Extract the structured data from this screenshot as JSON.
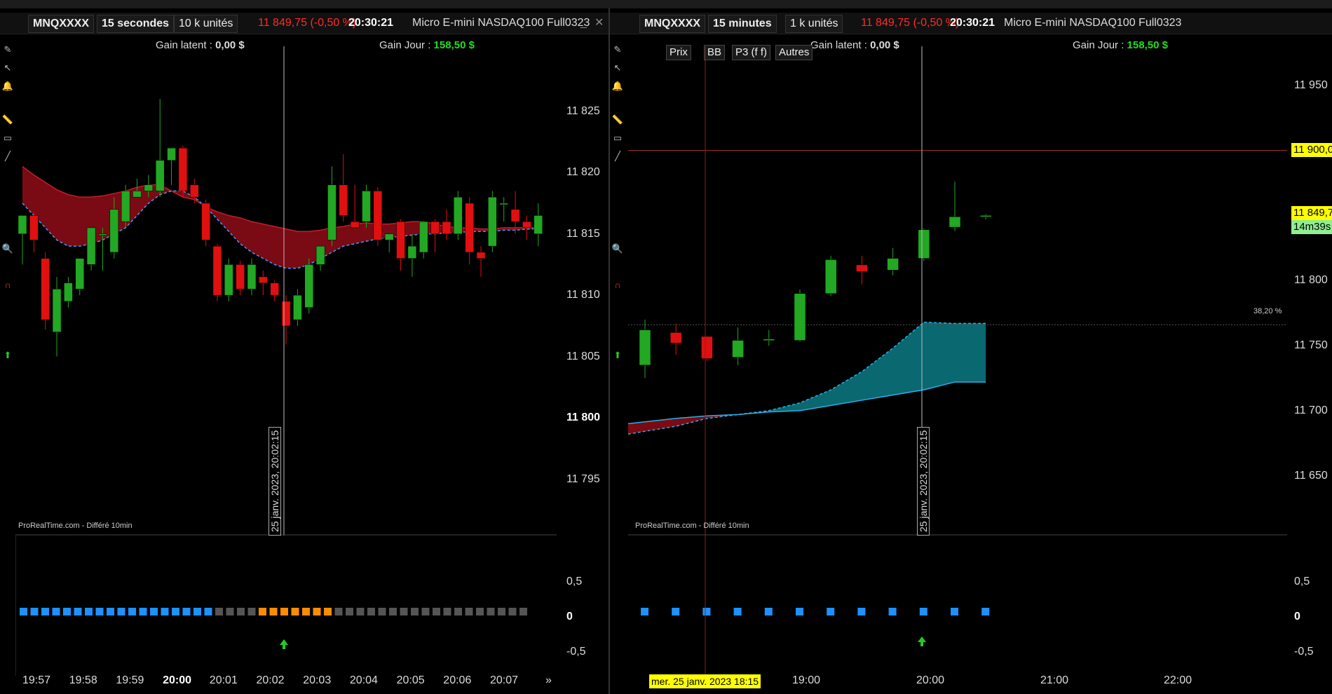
{
  "left": {
    "symbol": "MNQXXXX",
    "interval": "15 secondes",
    "units": "10 k unités",
    "price_change": "11 849,75 (-0,50 %)",
    "time": "20:30:21",
    "instrument": "Micro E-mini NASDAQ100 Full0323",
    "gain_latent_label": "Gain latent :",
    "gain_latent_value": "0,00 $",
    "gain_jour_label": "Gain Jour :",
    "gain_jour_value": "158,50 $",
    "watermark": "ProRealTime.com - Différé 10min",
    "cursor_date": "25 janv. 2023, 20:02:15",
    "price_ticks": [
      "11 825",
      "11 820",
      "11 815",
      "11 810",
      "11 805",
      "11 800",
      "11 795"
    ],
    "osc_ticks": [
      "0,5",
      "0",
      "-0,5"
    ],
    "time_ticks": [
      "19:57",
      "19:58",
      "19:59",
      "20:00",
      "20:01",
      "20:02",
      "20:03",
      "20:04",
      "20:05",
      "20:06",
      "20:07"
    ],
    "scroll_label": "»"
  },
  "right": {
    "symbol": "MNQXXXX",
    "interval": "15 minutes",
    "units": "1 k unités",
    "price_change": "11 849,75 (-0,50 %)",
    "time": "20:30:21",
    "instrument": "Micro E-mini NASDAQ100 Full0323",
    "gain_latent_label": "Gain latent :",
    "gain_latent_value": "0,00 $",
    "gain_jour_label": "Gain Jour :",
    "gain_jour_value": "158,50 $",
    "legend": [
      "Prix",
      "BB",
      "P3 (f f)",
      "Autres"
    ],
    "watermark": "ProRealTime.com - Différé 10min",
    "cursor_date": "25 janv. 2023, 20:02:15",
    "price_ticks": [
      "11 950",
      "11 800",
      "11 750",
      "11 700",
      "11 650"
    ],
    "level_tag": "11 900,0",
    "last_price_tag": "11 849,7",
    "countdown_tag": "14m39s",
    "fib_label": "38,20 %",
    "osc_ticks": [
      "0,5",
      "0",
      "-0,5"
    ],
    "date_tag": "mer. 25 janv. 2023 18:15",
    "time_ticks": [
      "19:00",
      "20:00",
      "21:00",
      "22:00"
    ]
  },
  "colors": {
    "bull": "#22a822",
    "bear": "#e01010",
    "cloud_down": "#7a0a14",
    "cloud_up": "#0a6870",
    "dot_blue": "#1e90ff",
    "dot_gray": "#555555",
    "dot_orange": "#ff8c00",
    "tag_yellow": "#ffff00",
    "tag_green": "#90ee90"
  },
  "left_candles": [
    {
      "o": 11815.0,
      "h": 11816.5,
      "l": 11812.5,
      "c": 11816.5
    },
    {
      "o": 11816.5,
      "h": 11816.8,
      "l": 11813.5,
      "c": 11814.5
    },
    {
      "o": 11813.0,
      "h": 11813.5,
      "l": 11807.2,
      "c": 11808.0
    },
    {
      "o": 11807.0,
      "h": 11811.5,
      "l": 11805.0,
      "c": 11810.5
    },
    {
      "o": 11809.5,
      "h": 11811.5,
      "l": 11809.0,
      "c": 11811.0
    },
    {
      "o": 11810.5,
      "h": 11812.0,
      "l": 11810.0,
      "c": 11813.0
    },
    {
      "o": 11812.5,
      "h": 11815.5,
      "l": 11812.0,
      "c": 11815.5
    },
    {
      "o": 11815.0,
      "h": 11815.5,
      "l": 11812.0,
      "c": 11815.0
    },
    {
      "o": 11813.5,
      "h": 11818.0,
      "l": 11813.0,
      "c": 11817.0
    },
    {
      "o": 11816.0,
      "h": 11819.0,
      "l": 11815.5,
      "c": 11818.5
    },
    {
      "o": 11818.0,
      "h": 11819.5,
      "l": 11818.0,
      "c": 11818.5
    },
    {
      "o": 11818.5,
      "h": 11819.8,
      "l": 11818.0,
      "c": 11819.0
    },
    {
      "o": 11818.5,
      "h": 11826.0,
      "l": 11818.0,
      "c": 11821.0
    },
    {
      "o": 11821.0,
      "h": 11821.5,
      "l": 11819.0,
      "c": 11822.0
    },
    {
      "o": 11822.0,
      "h": 11822.2,
      "l": 11818.0,
      "c": 11818.5
    },
    {
      "o": 11819.0,
      "h": 11819.5,
      "l": 11817.5,
      "c": 11818.0
    },
    {
      "o": 11817.5,
      "h": 11817.8,
      "l": 11814.0,
      "c": 11814.5
    },
    {
      "o": 11814.0,
      "h": 11814.2,
      "l": 11809.5,
      "c": 11810.0
    },
    {
      "o": 11810.0,
      "h": 11813.0,
      "l": 11809.5,
      "c": 11812.5
    },
    {
      "o": 11812.5,
      "h": 11812.8,
      "l": 11810.0,
      "c": 11810.5
    },
    {
      "o": 11810.5,
      "h": 11813.0,
      "l": 11810.0,
      "c": 11812.5
    },
    {
      "o": 11811.5,
      "h": 11812.0,
      "l": 11810.0,
      "c": 11811.0
    },
    {
      "o": 11811.0,
      "h": 11811.2,
      "l": 11809.5,
      "c": 11810.0
    },
    {
      "o": 11809.5,
      "h": 11810.0,
      "l": 11806.0,
      "c": 11807.5
    },
    {
      "o": 11808.0,
      "h": 11810.5,
      "l": 11807.5,
      "c": 11810.0
    },
    {
      "o": 11809.0,
      "h": 11813.0,
      "l": 11808.5,
      "c": 11812.5
    },
    {
      "o": 11812.5,
      "h": 11814.0,
      "l": 11812.0,
      "c": 11814.0
    },
    {
      "o": 11814.5,
      "h": 11820.5,
      "l": 11814.0,
      "c": 11819.0
    },
    {
      "o": 11819.0,
      "h": 11821.5,
      "l": 11816.0,
      "c": 11816.5
    },
    {
      "o": 11816.0,
      "h": 11819.0,
      "l": 11815.5,
      "c": 11815.5
    },
    {
      "o": 11816.0,
      "h": 11819.0,
      "l": 11815.5,
      "c": 11818.5
    },
    {
      "o": 11818.5,
      "h": 11818.8,
      "l": 11814.0,
      "c": 11814.5
    },
    {
      "o": 11814.5,
      "h": 11815.0,
      "l": 11813.5,
      "c": 11815.0
    },
    {
      "o": 11816.0,
      "h": 11816.2,
      "l": 11812.0,
      "c": 11813.0
    },
    {
      "o": 11813.0,
      "h": 11815.0,
      "l": 11811.5,
      "c": 11814.0
    },
    {
      "o": 11813.5,
      "h": 11816.0,
      "l": 11813.0,
      "c": 11816.0
    },
    {
      "o": 11816.0,
      "h": 11816.2,
      "l": 11813.5,
      "c": 11815.0
    },
    {
      "o": 11816.0,
      "h": 11817.0,
      "l": 11814.5,
      "c": 11815.0
    },
    {
      "o": 11815.0,
      "h": 11818.5,
      "l": 11814.5,
      "c": 11818.0
    },
    {
      "o": 11817.5,
      "h": 11818.0,
      "l": 11812.5,
      "c": 11813.5
    },
    {
      "o": 11813.5,
      "h": 11814.0,
      "l": 11811.5,
      "c": 11813.0
    },
    {
      "o": 11814.0,
      "h": 11818.5,
      "l": 11813.5,
      "c": 11818.0
    },
    {
      "o": 11817.5,
      "h": 11818.0,
      "l": 11816.0,
      "c": 11817.5
    },
    {
      "o": 11817.0,
      "h": 11818.5,
      "l": 11815.0,
      "c": 11816.0
    },
    {
      "o": 11816.0,
      "h": 11816.5,
      "l": 11814.5,
      "c": 11815.5
    },
    {
      "o": 11815.0,
      "h": 11817.5,
      "l": 11814.0,
      "c": 11816.5
    }
  ],
  "right_candles": [
    {
      "o": 11735,
      "h": 11770,
      "l": 11725,
      "c": 11762
    },
    {
      "o": 11760,
      "h": 11767,
      "l": 11743,
      "c": 11752
    },
    {
      "o": 11757,
      "h": 11757,
      "l": 11738,
      "c": 11740
    },
    {
      "o": 11741,
      "h": 11764,
      "l": 11735,
      "c": 11754
    },
    {
      "o": 11754,
      "h": 11762,
      "l": 11750,
      "c": 11755
    },
    {
      "o": 11754,
      "h": 11793,
      "l": 11753,
      "c": 11790
    },
    {
      "o": 11790,
      "h": 11819,
      "l": 11788,
      "c": 11816
    },
    {
      "o": 11812,
      "h": 11819,
      "l": 11797,
      "c": 11807
    },
    {
      "o": 11808,
      "h": 11825,
      "l": 11804,
      "c": 11817
    },
    {
      "o": 11817,
      "h": 11840,
      "l": 11815,
      "c": 11839
    },
    {
      "o": 11841,
      "h": 11876,
      "l": 11838,
      "c": 11849
    },
    {
      "o": 11849,
      "h": 11851,
      "l": 11847,
      "c": 11850
    }
  ],
  "left_cloud": {
    "upper": [
      11820.5,
      11819.8,
      11819.2,
      11818.6,
      11818.2,
      11818.0,
      11818.0,
      11818.1,
      11818.3,
      11818.5,
      11818.8,
      11819.0,
      11819.0,
      11818.5,
      11818.0,
      11817.8,
      11817.2,
      11816.8,
      11816.5,
      11816.3,
      11816.0,
      11815.8,
      11815.6,
      11815.4,
      11815.2,
      11815.2,
      11815.3,
      11815.5,
      11815.6,
      11815.8,
      11815.9,
      11815.8,
      11815.8,
      11815.9,
      11816.0,
      11816.0,
      11815.8,
      11815.6,
      11815.5,
      11815.5,
      11815.4,
      11815.4,
      11815.5,
      11815.5,
      11815.5,
      11815.5
    ],
    "lower": [
      11817.5,
      11816.5,
      11815.5,
      11814.5,
      11814.0,
      11814.0,
      11814.2,
      11814.5,
      11815.0,
      11815.5,
      11816.5,
      11817.5,
      11818.2,
      11818.5,
      11818.5,
      11818.0,
      11817.2,
      11816.2,
      11815.2,
      11814.2,
      11813.5,
      11813.0,
      11812.5,
      11812.2,
      11812.2,
      11812.5,
      11813.0,
      11813.5,
      11814.0,
      11814.2,
      11814.4,
      11814.6,
      11814.7,
      11814.8,
      11814.9,
      11815.0,
      11815.0,
      11815.1,
      11815.1,
      11815.2,
      11815.2,
      11815.2,
      11815.3,
      11815.3,
      11815.4,
      11815.4
    ]
  },
  "right_cloud": {
    "upper": [
      11690,
      11694,
      11696,
      11697,
      11699,
      11700,
      11704,
      11708,
      11712,
      11716,
      11722,
      11722
    ],
    "lower": [
      11682,
      11688,
      11694,
      11697,
      11700,
      11706,
      11716,
      11730,
      11748,
      11768,
      11767,
      11767
    ]
  },
  "left_dots": "bbbbbbbbbbbbbbbbbbggggooooooogggggggggggggggggg",
  "right_dots": "bbbbbbbbbbbb"
}
